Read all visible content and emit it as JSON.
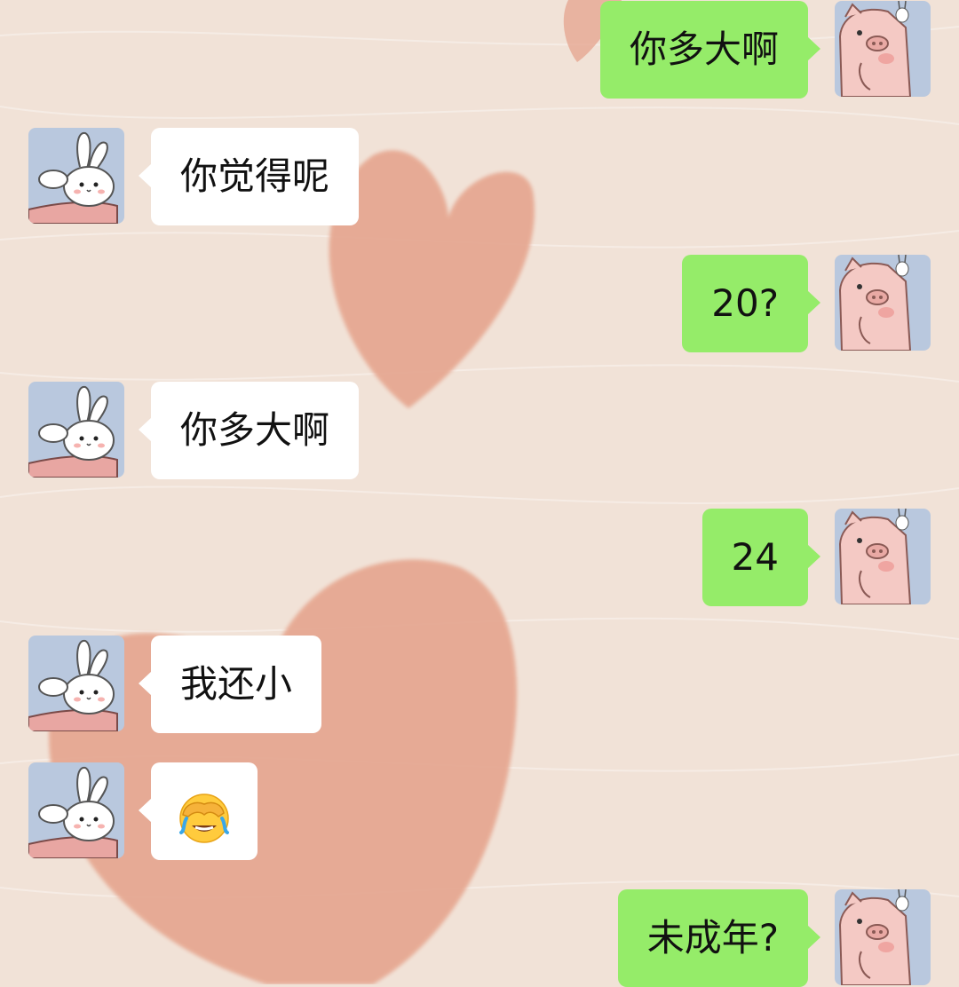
{
  "chat": {
    "messages": [
      {
        "sender": "me",
        "text": "你多大啊"
      },
      {
        "sender": "them",
        "text": "你觉得呢"
      },
      {
        "sender": "me",
        "text": "20?"
      },
      {
        "sender": "them",
        "text": "你多大啊"
      },
      {
        "sender": "me",
        "text": "24"
      },
      {
        "sender": "them",
        "text": "我还小"
      },
      {
        "sender": "them",
        "emoji": "face-palm-laughing-emoji"
      },
      {
        "sender": "me",
        "text": "未成年?"
      }
    ],
    "avatars": {
      "me": "pig-avatar",
      "them": "bunny-avatar"
    }
  },
  "colors": {
    "background": "#f1e2d7",
    "heart": "#e6a892",
    "my_bubble": "#95ec69",
    "their_bubble": "#ffffff"
  }
}
